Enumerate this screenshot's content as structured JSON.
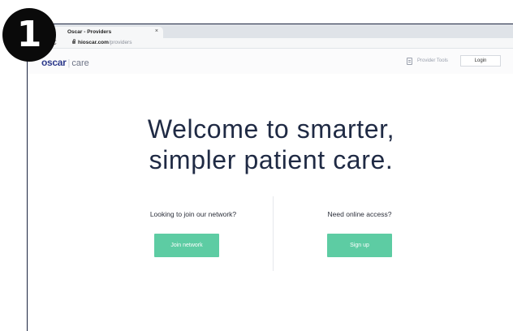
{
  "step_badge": {
    "number": "1"
  },
  "browser": {
    "tab": {
      "title": "Oscar - Providers",
      "close_glyph": "×"
    },
    "address": {
      "host": "hioscar.com",
      "path": "/providers"
    },
    "reload_glyph": "C"
  },
  "header": {
    "logo": {
      "brand": "oscar",
      "separator": "|",
      "product": "care"
    },
    "provider_tools_label": "Provider Tools",
    "login_label": "Login"
  },
  "hero": {
    "title_lines": [
      "Welcome to smarter,",
      "simpler patient care."
    ]
  },
  "cta": {
    "left": {
      "question": "Looking to join our network?",
      "button_label": "Join network"
    },
    "right": {
      "question": "Need online access?",
      "button_label": "Sign up"
    }
  },
  "colors": {
    "brand": "#2d3a8c",
    "cta_green": "#5dcca3",
    "title_text": "#1f2a44",
    "badge": "#0a0a0a"
  },
  "icons": {
    "favicon": "oscar-favicon-icon",
    "lock": "lock-icon",
    "reload": "reload-icon",
    "provider_tools": "document-icon"
  }
}
